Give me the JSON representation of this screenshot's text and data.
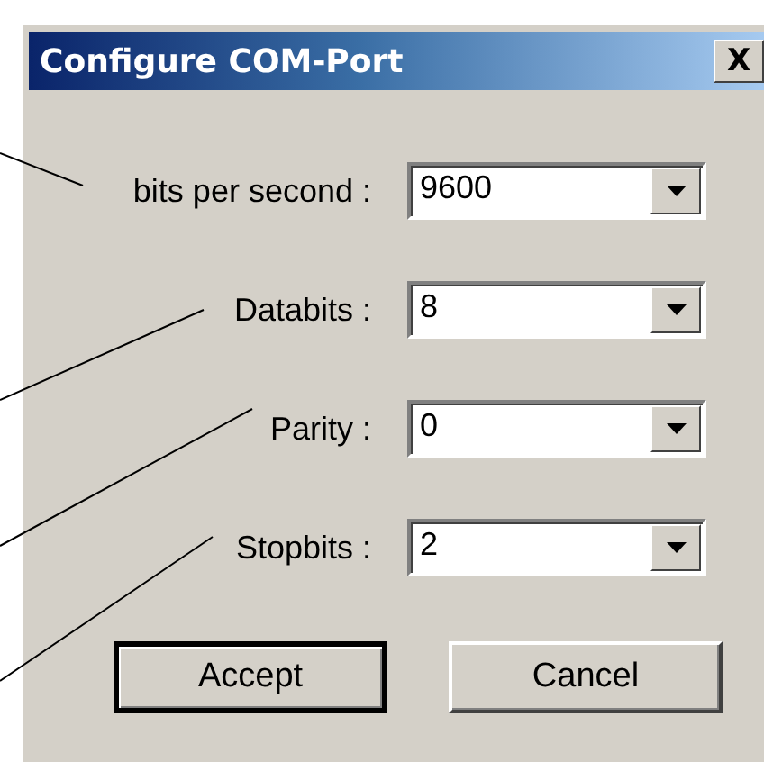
{
  "window": {
    "title": "Configure COM-Port",
    "close": "X"
  },
  "fields": [
    {
      "label": "bits per second :",
      "value": "9600"
    },
    {
      "label": "Databits :",
      "value": "8"
    },
    {
      "label": "Parity :",
      "value": "0"
    },
    {
      "label": "Stopbits :",
      "value": "2"
    }
  ],
  "buttons": [
    {
      "label": "Accept",
      "default": true
    },
    {
      "label": "Cancel",
      "default": false
    }
  ]
}
